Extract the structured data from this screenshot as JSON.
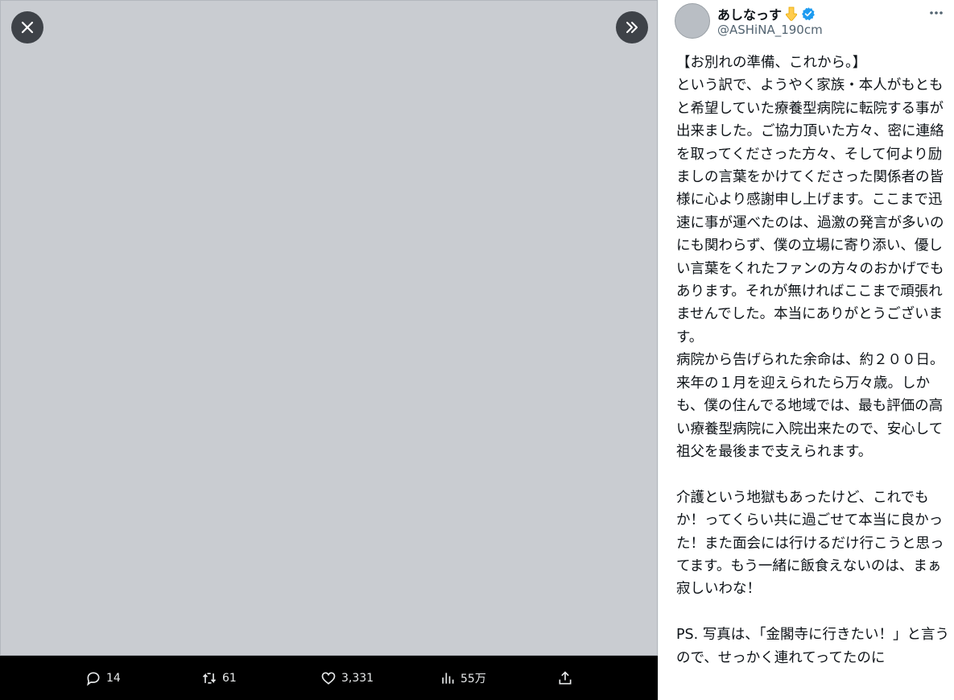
{
  "media": {
    "close_icon": "close-icon",
    "expand_icon": "double-chevron-right-icon"
  },
  "actions": {
    "reply_count": "14",
    "retweet_count": "61",
    "like_count": "3,331",
    "views_count": "55万"
  },
  "author": {
    "display_name": "あしなっす",
    "handle": "@ASHiNA_190cm",
    "verified": true
  },
  "tweet": {
    "text": "【お別れの準備、これから。】\nという訳で、ようやく家族・本人がもともと希望していた療養型病院に転院する事が出来ました。ご協力頂いた方々、密に連絡を取ってくださった方々、そして何より励ましの言葉をかけてくださった関係者の皆様に心より感謝申し上げます。ここまで迅速に事が運べたのは、過激の発言が多いのにも関わらず、僕の立場に寄り添い、優しい言葉をくれたファンの方々のおかげでもあります。それが無ければここまで頑張れませんでした。本当にありがとうございます。\n病院から告げられた余命は、約２００日。来年の１月を迎えられたら万々歳。しかも、僕の住んでる地域では、最も評価の高い療養型病院に入院出来たので、安心して祖父を最後まで支えられます。\n\n介護という地獄もあったけど、これでもか！ってくらい共に過ごせて本当に良かった！また面会には行けるだけ行こうと思ってます。もう一緒に飯食えないのは、まぁ寂しいわな！\n\nPS. 写真は、「金閣寺に行きたい！」と言うので、せっかく連れてってたのに"
  },
  "colors": {
    "verified_blue": "#1d9bf0",
    "action_text": "#e7e9ea"
  }
}
